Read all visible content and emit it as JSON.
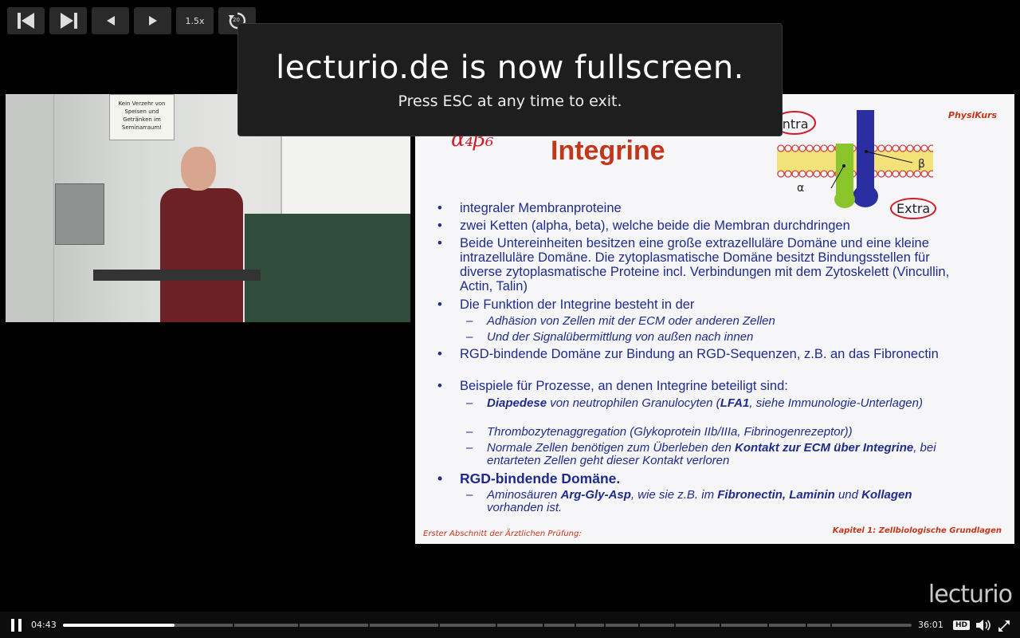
{
  "controls": {
    "prev_chapter": "previous-chapter",
    "next_chapter": "next-chapter",
    "speed": "1.5x",
    "replay": "20"
  },
  "notice": {
    "title": "lecturio.de is now fullscreen.",
    "subtitle": "Press ESC at any time to exit."
  },
  "video": {
    "sign_text": "Kein Verzehr von Speisen und Getränken im Seminarraum!"
  },
  "slide": {
    "handwriting": "α₄β₆",
    "title": "Integrine",
    "brand": "PhysiKurs",
    "labels": {
      "intra": "Intra",
      "extra": "Extra",
      "alpha": "α",
      "beta": "β"
    },
    "bullets": [
      "integraler Membranproteine",
      "zwei Ketten (alpha, beta), welche beide die Membran durchdringen",
      "Beide Untereinheiten besitzen eine große extrazelluläre Domäne und eine kleine intrazelluläre Domäne. Die zytoplasmatische Domäne besitzt Bindungsstellen für diverse zytoplasmatische Proteine incl. Verbindungen mit dem Zytoskelett (Vincullin, Actin, Talin)",
      "Die Funktion der Integrine besteht in der",
      "RGD-bindende Domäne zur Bindung an RGD-Sequenzen, z.B. an das Fibronectin",
      "Beispiele für Prozesse, an denen Integrine beteiligt sind:",
      "RGD-bindende Domäne."
    ],
    "sub_funktion": [
      "Adhäsion von Zellen mit der ECM oder anderen Zellen",
      "Und der Signalübermittlung von außen nach innen"
    ],
    "sub_beispiele": {
      "diapedese_bold": "Diapedese",
      "diapedese_rest1": " von neutrophilen Granulocyten (",
      "lfa1": "LFA1",
      "diapedese_rest2": ", siehe Immunologie-Unterlagen)",
      "thrombo": "Thrombozytenaggregation (Glykoprotein IIb/IIIa, Fibrinogenrezeptor))",
      "normale_1": "Normale Zellen benötigen zum Überleben den ",
      "normale_bold": "Kontakt zur ECM über Integrine",
      "normale_2": ", bei entarteten Zellen geht dieser Kontakt verloren"
    },
    "sub_rgd": {
      "p1": "Aminosäuren ",
      "b1": "Arg-Gly-Asp",
      "p2": ", wie sie z.B. im ",
      "b2": "Fibronectin, Laminin",
      "p3": " und ",
      "b3": "Kollagen",
      "p4": " vorhanden ist."
    },
    "footer_left": "Erster Abschnitt der Ärztlichen Prüfung:",
    "footer_right": "Kapitel 1: Zellbiologische Grundlagen"
  },
  "logo": "lecturio",
  "player": {
    "current_time": "04:43",
    "total_time": "36:01",
    "progress": 0.131,
    "chapter_marks": [
      0.2,
      0.277,
      0.36,
      0.442,
      0.51,
      0.565,
      0.603,
      0.638,
      0.678,
      0.72,
      0.774,
      0.83,
      0.875,
      0.904
    ],
    "hd_label": "HD"
  }
}
